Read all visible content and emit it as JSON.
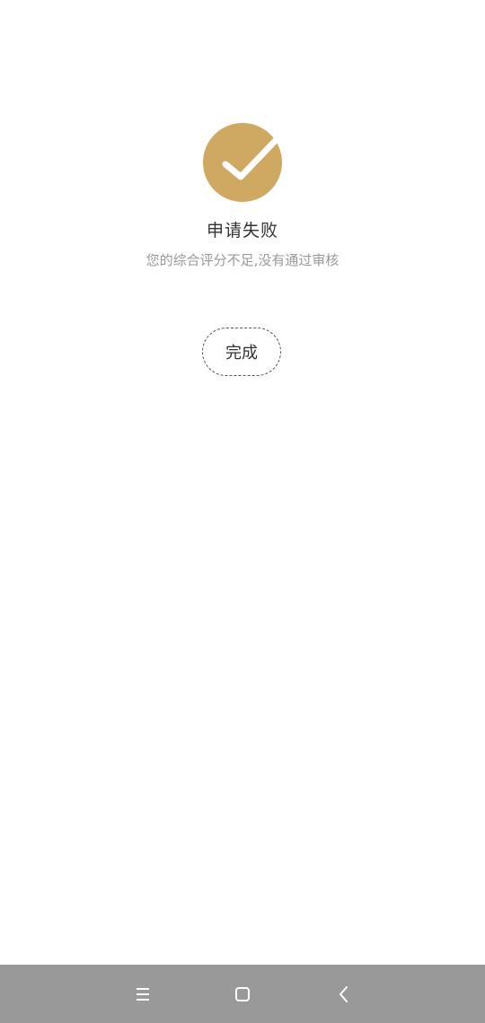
{
  "result": {
    "title": "申请失败",
    "message": "您的综合评分不足,没有通过审核",
    "icon": "check-circle-icon",
    "accent_color": "#CFA862"
  },
  "actions": {
    "done_label": "完成"
  },
  "navigation_bar": {
    "background": "#999999",
    "items": [
      {
        "icon": "menu-icon"
      },
      {
        "icon": "home-icon"
      },
      {
        "icon": "back-icon"
      }
    ]
  }
}
